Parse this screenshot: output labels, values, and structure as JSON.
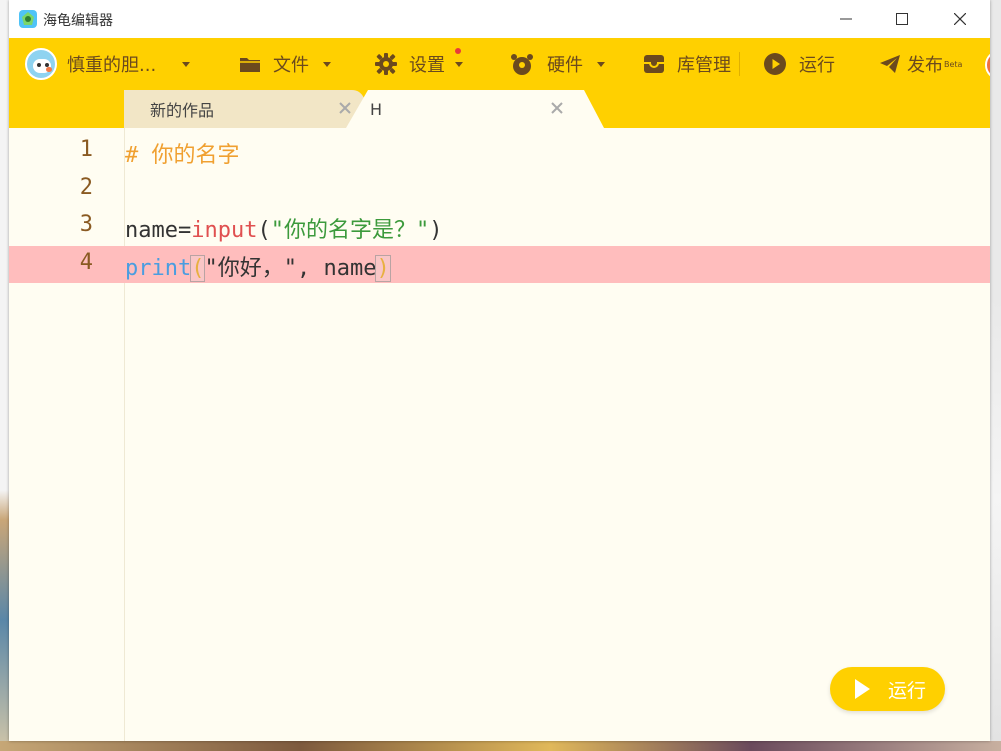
{
  "window": {
    "title": "海龟编辑器",
    "controls": [
      "minimize",
      "maximize",
      "close"
    ]
  },
  "toolbar": {
    "user_name": "慎重的胆...",
    "items": [
      {
        "label": "文件",
        "icon": "folder-icon",
        "has_dropdown": true
      },
      {
        "label": "设置",
        "icon": "gear-icon",
        "has_dropdown": true,
        "notification": true
      },
      {
        "label": "硬件",
        "icon": "hardware-icon",
        "has_dropdown": true
      },
      {
        "label": "库管理",
        "icon": "library-icon",
        "has_dropdown": false
      },
      {
        "label": "运行",
        "icon": "play-circle-icon",
        "has_dropdown": false
      },
      {
        "label": "发布",
        "badge": "Beta",
        "icon": "paper-plane-icon",
        "has_dropdown": false
      }
    ]
  },
  "tabs": [
    {
      "label": "新的作品",
      "active": false
    },
    {
      "label": "H",
      "active": true
    }
  ],
  "editor": {
    "active_line": 4,
    "lines": [
      {
        "number": "1",
        "text": "# 你的名字"
      },
      {
        "number": "2",
        "text": ""
      },
      {
        "number": "3",
        "text": "name=input(\"你的名字是？\")"
      },
      {
        "number": "4",
        "text": "print(\"你好，\", name)"
      }
    ],
    "tokens": {
      "l1_comment": "# 你的名字",
      "l3_var": "name=",
      "l3_func": "input",
      "l3_open": "(",
      "l3_str": "\"你的名字是？\"",
      "l3_close": ")",
      "l4_func": "print",
      "l4_open": "(",
      "l4_args": "\"你好，\", name",
      "l4_close": ")"
    }
  },
  "run_button": {
    "label": "运行"
  },
  "colors": {
    "accent": "#ffd000",
    "toolbar_text": "#6b4a1e",
    "editor_bg": "#fffdf2",
    "active_line": "#ffbdbd"
  }
}
